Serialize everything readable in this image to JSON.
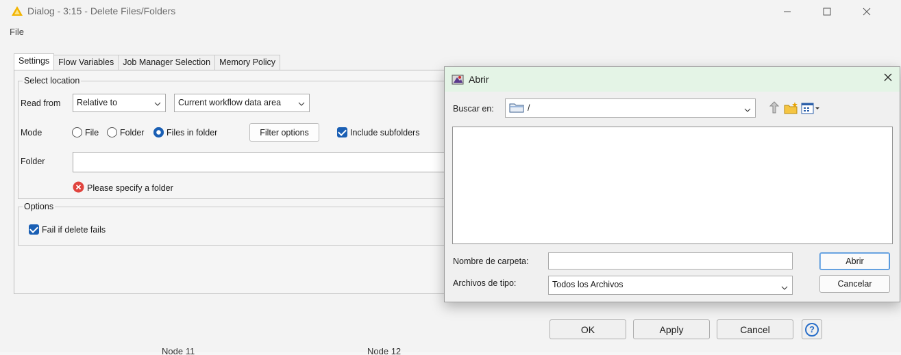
{
  "window": {
    "title": "Dialog - 3:15 - Delete Files/Folders",
    "menu_file": "File",
    "minimize": "—",
    "maximize": "☐",
    "close": "✕"
  },
  "tabs": [
    {
      "label": "Settings",
      "active": true
    },
    {
      "label": "Flow Variables",
      "active": false
    },
    {
      "label": "Job Manager Selection",
      "active": false
    },
    {
      "label": "Memory Policy",
      "active": false
    }
  ],
  "select_location": {
    "legend": "Select location",
    "read_from_label": "Read from",
    "read_from_value": "Relative to",
    "relative_target_value": "Current workflow data area",
    "mode_label": "Mode",
    "mode_options": [
      "File",
      "Folder",
      "Files in folder"
    ],
    "mode_selected": "Files in folder",
    "filter_options_button": "Filter options",
    "include_subfolders_label": "Include subfolders",
    "include_subfolders_checked": true,
    "folder_label": "Folder",
    "folder_value": "",
    "error_text": "Please specify a folder"
  },
  "options": {
    "legend": "Options",
    "fail_if_delete_fails_label": "Fail if delete fails",
    "fail_if_delete_fails_checked": true
  },
  "footer": {
    "ok": "OK",
    "apply": "Apply",
    "cancel": "Cancel",
    "help": "?"
  },
  "file_chooser": {
    "title": "Abrir",
    "look_in_label": "Buscar en:",
    "look_in_value": "/",
    "folder_name_label": "Nombre de carpeta:",
    "folder_name_value": "",
    "file_type_label": "Archivos de tipo:",
    "file_type_value": "Todos los Archivos",
    "open_button": "Abrir",
    "cancel_button": "Cancelar",
    "close": "✕"
  },
  "background": {
    "node_left": "Node 11",
    "node_right": "Node 12"
  },
  "colors": {
    "accent": "#1a5fb4",
    "error": "#e0443e",
    "warning_icon": "#f2b400",
    "chooser_title_bg": "#e4f4e6"
  }
}
